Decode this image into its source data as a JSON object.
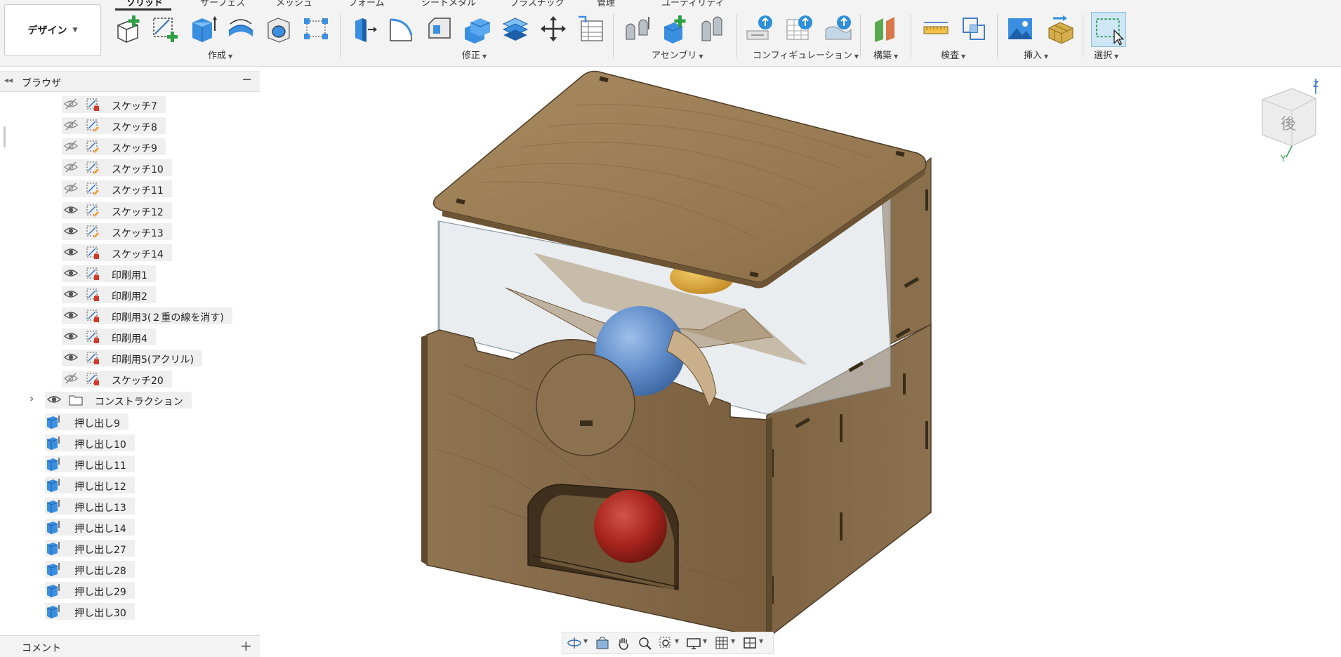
{
  "ribbon": {
    "tabs": [
      "ソリッド",
      "サーフェス",
      "メッシュ",
      "フォーム",
      "シートメタル",
      "プラスチック",
      "管理",
      "ユーティリティ"
    ],
    "workspace_button": "デザイン",
    "groups": {
      "create": "作成",
      "modify": "修正",
      "assembly": "アセンブリ",
      "configuration": "コンフィギュレーション",
      "construct": "構築",
      "inspect": "検査",
      "insert": "挿入",
      "select": "選択"
    },
    "icons": [
      "new-component-icon",
      "create-sketch-icon",
      "extrude-icon",
      "revolve-icon",
      "hole-icon",
      "pattern-icon",
      "press-pull-icon",
      "fillet-icon",
      "chamfer-icon",
      "shell-icon",
      "combine-icon",
      "move-icon",
      "parameters-icon",
      "joint-icon",
      "new-assembly-component-icon",
      "as-built-joint-icon",
      "configure-icon",
      "table-icon",
      "config-rules-icon",
      "offset-plane-icon",
      "measure-icon",
      "interference-icon",
      "insert-image-icon",
      "insert-mesh-icon",
      "select-window-icon"
    ]
  },
  "browser": {
    "title": "ブラウザ",
    "items": [
      {
        "label": "スケッチ7",
        "visible": false,
        "type": "sketch"
      },
      {
        "label": "スケッチ8",
        "visible": false,
        "type": "sketch"
      },
      {
        "label": "スケッチ9",
        "visible": false,
        "type": "sketch"
      },
      {
        "label": "スケッチ10",
        "visible": false,
        "type": "sketch"
      },
      {
        "label": "スケッチ11",
        "visible": false,
        "type": "sketch"
      },
      {
        "label": "スケッチ12",
        "visible": true,
        "type": "sketch"
      },
      {
        "label": "スケッチ13",
        "visible": true,
        "type": "sketch"
      },
      {
        "label": "スケッチ14",
        "visible": true,
        "type": "sketch"
      },
      {
        "label": "印刷用1",
        "visible": true,
        "type": "sketch"
      },
      {
        "label": "印刷用2",
        "visible": true,
        "type": "sketch"
      },
      {
        "label": "印刷用3(２重の線を消す)",
        "visible": true,
        "type": "sketch"
      },
      {
        "label": "印刷用4",
        "visible": true,
        "type": "sketch"
      },
      {
        "label": "印刷用5(アクリル)",
        "visible": true,
        "type": "sketch"
      },
      {
        "label": "スケッチ20",
        "visible": false,
        "type": "sketch"
      },
      {
        "label": "コンストラクション",
        "visible": true,
        "type": "folder"
      },
      {
        "label": "押し出し9",
        "type": "extrude"
      },
      {
        "label": "押し出し10",
        "type": "extrude"
      },
      {
        "label": "押し出し11",
        "type": "extrude"
      },
      {
        "label": "押し出し12",
        "type": "extrude"
      },
      {
        "label": "押し出し13",
        "type": "extrude"
      },
      {
        "label": "押し出し14",
        "type": "extrude"
      },
      {
        "label": "押し出し27",
        "type": "extrude"
      },
      {
        "label": "押し出し28",
        "type": "extrude"
      },
      {
        "label": "押し出し29",
        "type": "extrude"
      },
      {
        "label": "押し出し30",
        "type": "extrude"
      }
    ]
  },
  "comments": {
    "title": "コメント"
  },
  "viewcube": {
    "face_label": "後",
    "axis_labels": [
      "Z",
      "Y"
    ]
  },
  "colors": {
    "ribbon_bg": "#f3f3f3",
    "wood_light": "#9b7f58",
    "wood_dark": "#6f5637",
    "ball_blue": "#5d8ac7",
    "ball_red": "#a4231c",
    "ball_yellow": "#d9a53a",
    "accent_blue": "#2f8fdc"
  }
}
